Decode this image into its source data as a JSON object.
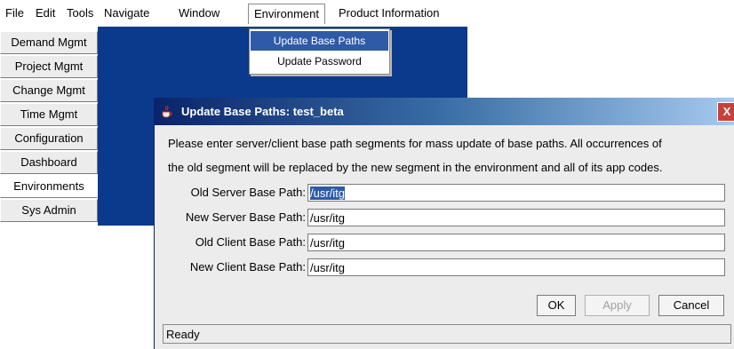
{
  "menubar": {
    "items": [
      "File",
      "Edit",
      "Tools",
      "Navigate",
      "Window",
      "Environment",
      "Product Information"
    ]
  },
  "dropdown": {
    "items": [
      "Update Base Paths",
      "Update Password"
    ]
  },
  "nav": {
    "items": [
      "Demand Mgmt",
      "Project Mgmt",
      "Change Mgmt",
      "Time Mgmt",
      "Configuration",
      "Dashboard",
      "Environments",
      "Sys Admin"
    ],
    "selected": "Environments"
  },
  "dialog": {
    "title": "Update Base Paths: test_beta",
    "close_label": "X",
    "instructions_line1": "Please enter server/client base path segments for mass update of base paths.  All occurrences of",
    "instructions_line2": "the old segment will be replaced by the new segment in the environment and all of its app codes.",
    "fields": [
      {
        "label": "Old Server Base Path:",
        "value": "/usr/itg"
      },
      {
        "label": "New Server Base Path:",
        "value": "/usr/itg"
      },
      {
        "label": "Old Client Base Path:",
        "value": "/usr/itg"
      },
      {
        "label": "New Client Base Path:",
        "value": "/usr/itg"
      }
    ],
    "buttons": {
      "ok": "OK",
      "apply": "Apply",
      "cancel": "Cancel"
    },
    "status": "Ready"
  },
  "colors": {
    "workspace": "#0b3a8c",
    "selection": "#2f5aa8",
    "dialog_bg": "#ececec"
  }
}
